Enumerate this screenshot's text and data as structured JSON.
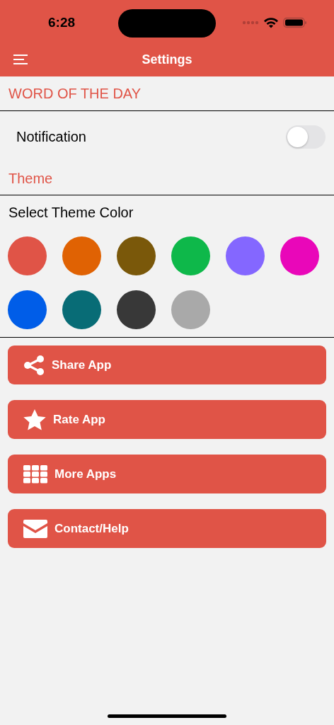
{
  "status_bar": {
    "time": "6:28"
  },
  "nav": {
    "title": "Settings"
  },
  "sections": [
    {
      "title": "WORD OF THE DAY"
    }
  ],
  "notification": {
    "label": "Notification",
    "on": false
  },
  "theme": {
    "title": "Theme",
    "subtitle": "Select Theme Color",
    "colors": [
      {
        "color": "#e05447"
      },
      {
        "color": "#e06203"
      },
      {
        "color": "#7a580a"
      },
      {
        "color": "#0eb84a"
      },
      {
        "color": "#8467ff"
      },
      {
        "color": "#e907b9"
      },
      {
        "color": "#005de8"
      },
      {
        "color": "#086c76"
      },
      {
        "color": "#383838"
      },
      {
        "color": "#a9a9a9"
      }
    ]
  },
  "buttons": [
    {
      "kind": "share",
      "label": "Share App"
    },
    {
      "kind": "star",
      "label": "Rate App"
    },
    {
      "kind": "grid",
      "label": "More Apps"
    },
    {
      "kind": "mail",
      "label": "Contact/Help"
    }
  ]
}
